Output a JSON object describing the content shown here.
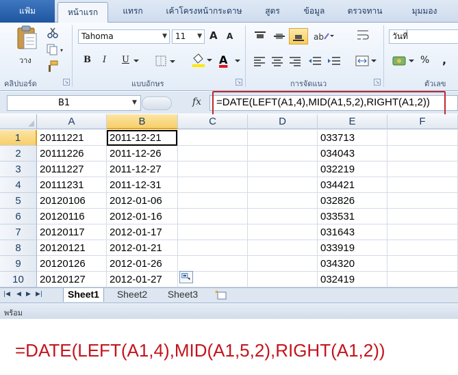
{
  "ribbon": {
    "tabs": [
      "แฟ้ม",
      "หน้าแรก",
      "แทรก",
      "เค้าโครงหน้ากระดาษ",
      "สูตร",
      "ข้อมูล",
      "ตรวจทาน",
      "มุมมอง"
    ],
    "font_name": "Tahoma",
    "font_size": "11",
    "number_format": "วันที่",
    "paste_label": "วาง",
    "groups": {
      "clipboard": "คลิปบอร์ด",
      "font": "แบบอักษร",
      "alignment": "การจัดแนว",
      "number": "ตัวเลข"
    },
    "buttons": {
      "grow_font": "A",
      "shrink_font": "A",
      "bold": "B",
      "italic": "I",
      "underline": "U",
      "font_color": "A",
      "percent": "%",
      "comma": ","
    }
  },
  "formula_bar": {
    "name_box": "B1",
    "fx": "fx",
    "formula": "=DATE(LEFT(A1,4),MID(A1,5,2),RIGHT(A1,2))"
  },
  "grid": {
    "columns": [
      "A",
      "B",
      "C",
      "D",
      "E",
      "F"
    ],
    "rows": [
      {
        "num": "1",
        "a": "20111221",
        "b": "2011-12-21",
        "e": "033713"
      },
      {
        "num": "2",
        "a": "20111226",
        "b": "2011-12-26",
        "e": "034043"
      },
      {
        "num": "3",
        "a": "20111227",
        "b": "2011-12-27",
        "e": "032219"
      },
      {
        "num": "4",
        "a": "20111231",
        "b": "2011-12-31",
        "e": "034421"
      },
      {
        "num": "5",
        "a": "20120106",
        "b": "2012-01-06",
        "e": "032826"
      },
      {
        "num": "6",
        "a": "20120116",
        "b": "2012-01-16",
        "e": "033531"
      },
      {
        "num": "7",
        "a": "20120117",
        "b": "2012-01-17",
        "e": "031643"
      },
      {
        "num": "8",
        "a": "20120121",
        "b": "2012-01-21",
        "e": "033919"
      },
      {
        "num": "9",
        "a": "20120126",
        "b": "2012-01-26",
        "e": "034320"
      },
      {
        "num": "10",
        "a": "20120127",
        "b": "2012-01-27",
        "e": "032419"
      }
    ]
  },
  "sheets": [
    "Sheet1",
    "Sheet2",
    "Sheet3"
  ],
  "status": "พร้อม",
  "caption": "=DATE(LEFT(A1,4),MID(A1,5,2),RIGHT(A1,2))",
  "colors": {
    "accent": "#c0262c",
    "selection": "#f8cf68",
    "file_tab": "#2a62ad"
  }
}
